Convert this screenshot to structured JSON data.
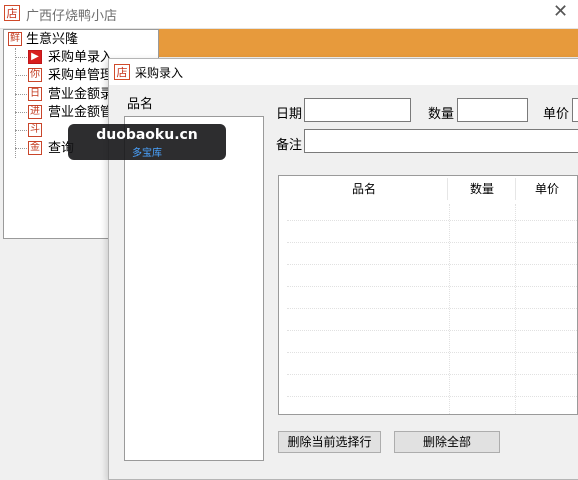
{
  "window": {
    "title": "广西仔烧鸭小店",
    "app_icon": "店",
    "close_glyph": "✕"
  },
  "tree": {
    "root": {
      "icon": "鲜",
      "label": "生意兴隆"
    },
    "items": [
      {
        "icon": "▶",
        "label": "采购单录入"
      },
      {
        "icon": "你",
        "label": "采购单管理"
      },
      {
        "icon": "日",
        "label": "营业金额录"
      },
      {
        "icon": "进",
        "label": "营业金额管"
      },
      {
        "icon": "斗",
        "label": ""
      },
      {
        "icon": "金",
        "label": "查询"
      }
    ]
  },
  "watermark": {
    "domain": "duobaoku.cn",
    "name": "多宝库"
  },
  "dialog": {
    "icon": "店",
    "title": "采购录入",
    "product_list_label": "品名",
    "date_label": "日期",
    "date_value": "",
    "quantity_label": "数量",
    "quantity_value": "",
    "price_label": "单价",
    "price_value": "",
    "note_label": "备注",
    "note_value": "",
    "grid_columns": [
      "品名",
      "数量",
      "单价"
    ],
    "delete_selected_label": "删除当前选择行",
    "delete_all_label": "删除全部"
  }
}
